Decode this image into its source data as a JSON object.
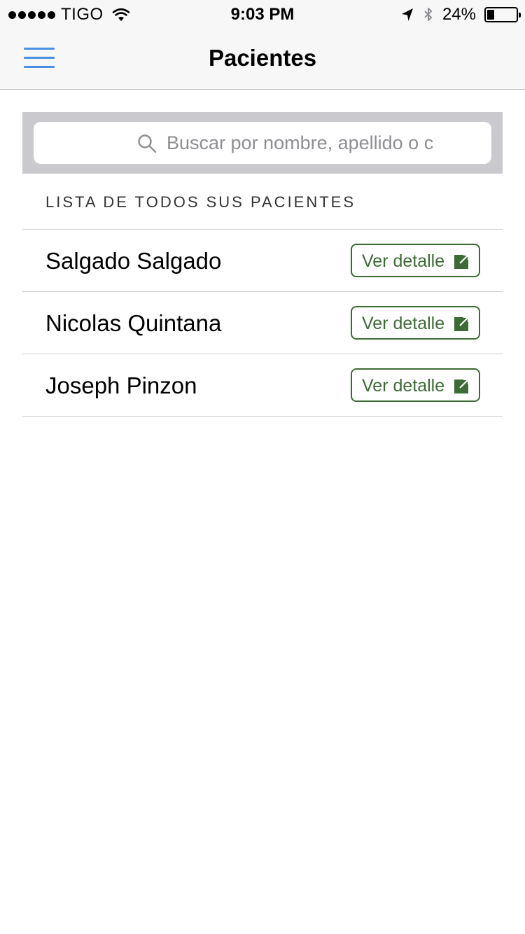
{
  "status_bar": {
    "carrier": "TIGO",
    "time": "9:03 PM",
    "battery": "24%",
    "battery_level": 0.24,
    "icons": [
      "signal-dots-icon",
      "wifi-icon",
      "location-arrow-icon",
      "bluetooth-icon",
      "battery-icon"
    ]
  },
  "nav": {
    "title": "Pacientes",
    "menu_icon": "hamburger-menu-icon",
    "accent_color": "#4a90e2"
  },
  "search": {
    "placeholder": "Buscar por nombre, apellido o c",
    "value": "",
    "icon": "search-icon"
  },
  "list": {
    "header": "LISTA DE TODOS SUS PACIENTES",
    "button_color": "#3d6b35",
    "patients": [
      {
        "name": "Salgado Salgado",
        "button_label": "Ver detalle"
      },
      {
        "name": "Nicolas Quintana",
        "button_label": "Ver detalle"
      },
      {
        "name": "Joseph Pinzon",
        "button_label": "Ver detalle"
      }
    ]
  }
}
